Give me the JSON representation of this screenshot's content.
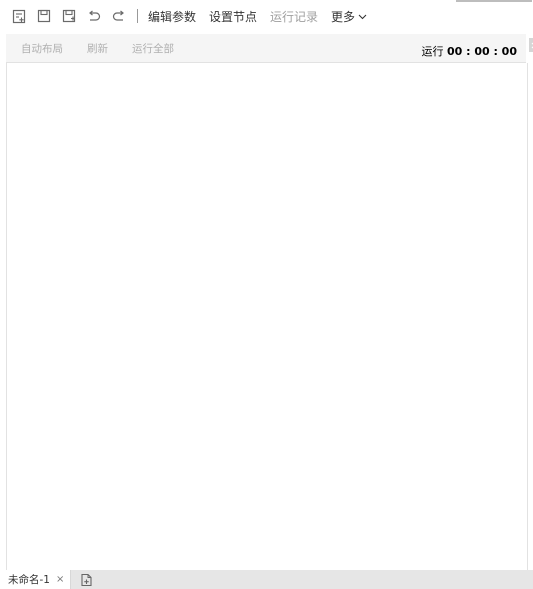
{
  "toolbar": {
    "icons": [
      "new-doc-icon",
      "save-icon",
      "save-as-icon",
      "undo-icon",
      "redo-icon"
    ],
    "edit_params": "编辑参数",
    "set_nodes": "设置节点",
    "run_records": "运行记录",
    "more": "更多"
  },
  "subbar": {
    "auto_layout": "自动布局",
    "refresh": "刷新",
    "run_all": "运行全部",
    "run_label": "运行",
    "run_time": "00 : 00 : 00"
  },
  "tabs": [
    {
      "label": "未命名-1",
      "close": "×"
    }
  ]
}
